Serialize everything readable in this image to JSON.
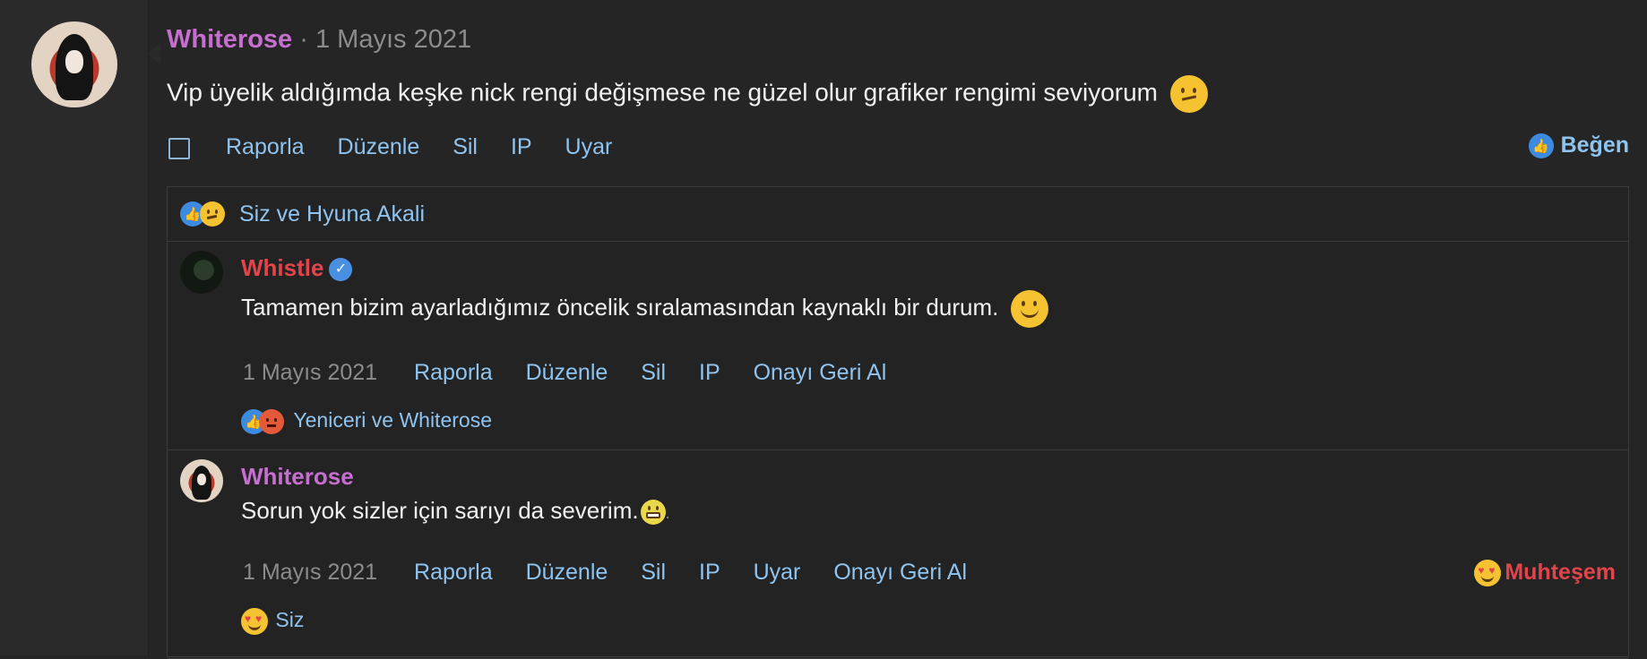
{
  "post": {
    "author": "Whiterose",
    "separator": "·",
    "date": "1 Mayıs 2021",
    "text": "Vip üyelik aldığımda keşke nick rengi değişmese ne güzel olur grafiker rengimi seviyorum",
    "actions": [
      "Raporla",
      "Düzenle",
      "Sil",
      "IP",
      "Uyar"
    ],
    "like_label": "Beğen",
    "reaction_summary": "Siz ve Hyuna Akali"
  },
  "replies": [
    {
      "author": "Whistle",
      "author_color": "#e1454b",
      "verified": true,
      "text": "Tamamen bizim ayarladığımız öncelik sıralamasından kaynaklı bir durum.",
      "date": "1 Mayıs 2021",
      "actions": [
        "Raporla",
        "Düzenle",
        "Sil",
        "IP",
        "Onayı Geri Al"
      ],
      "reactions": "Yeniceri ve Whiterose"
    },
    {
      "author": "Whiterose",
      "author_color": "#c76fd1",
      "verified": false,
      "text": "Sorun yok sizler için sarıyı da severim.",
      "text_suffix": ".",
      "date": "1 Mayıs 2021",
      "actions": [
        "Raporla",
        "Düzenle",
        "Sil",
        "IP",
        "Uyar",
        "Onayı Geri Al"
      ],
      "reaction_label": "Muhteşem",
      "reactions": "Siz"
    }
  ],
  "icons": {
    "like": "thumbs-up-icon",
    "confused": "confused-face-emoji",
    "smile": "smiling-face-emoji",
    "grin": "grinning-face-emoji",
    "angry": "angry-face-emoji",
    "heart_eyes": "heart-eyes-emoji",
    "verified": "verified-badge-icon"
  },
  "colors": {
    "background": "#252525",
    "link": "#8fc4f0",
    "username_purple": "#c76fd1",
    "username_red": "#e1454b"
  }
}
